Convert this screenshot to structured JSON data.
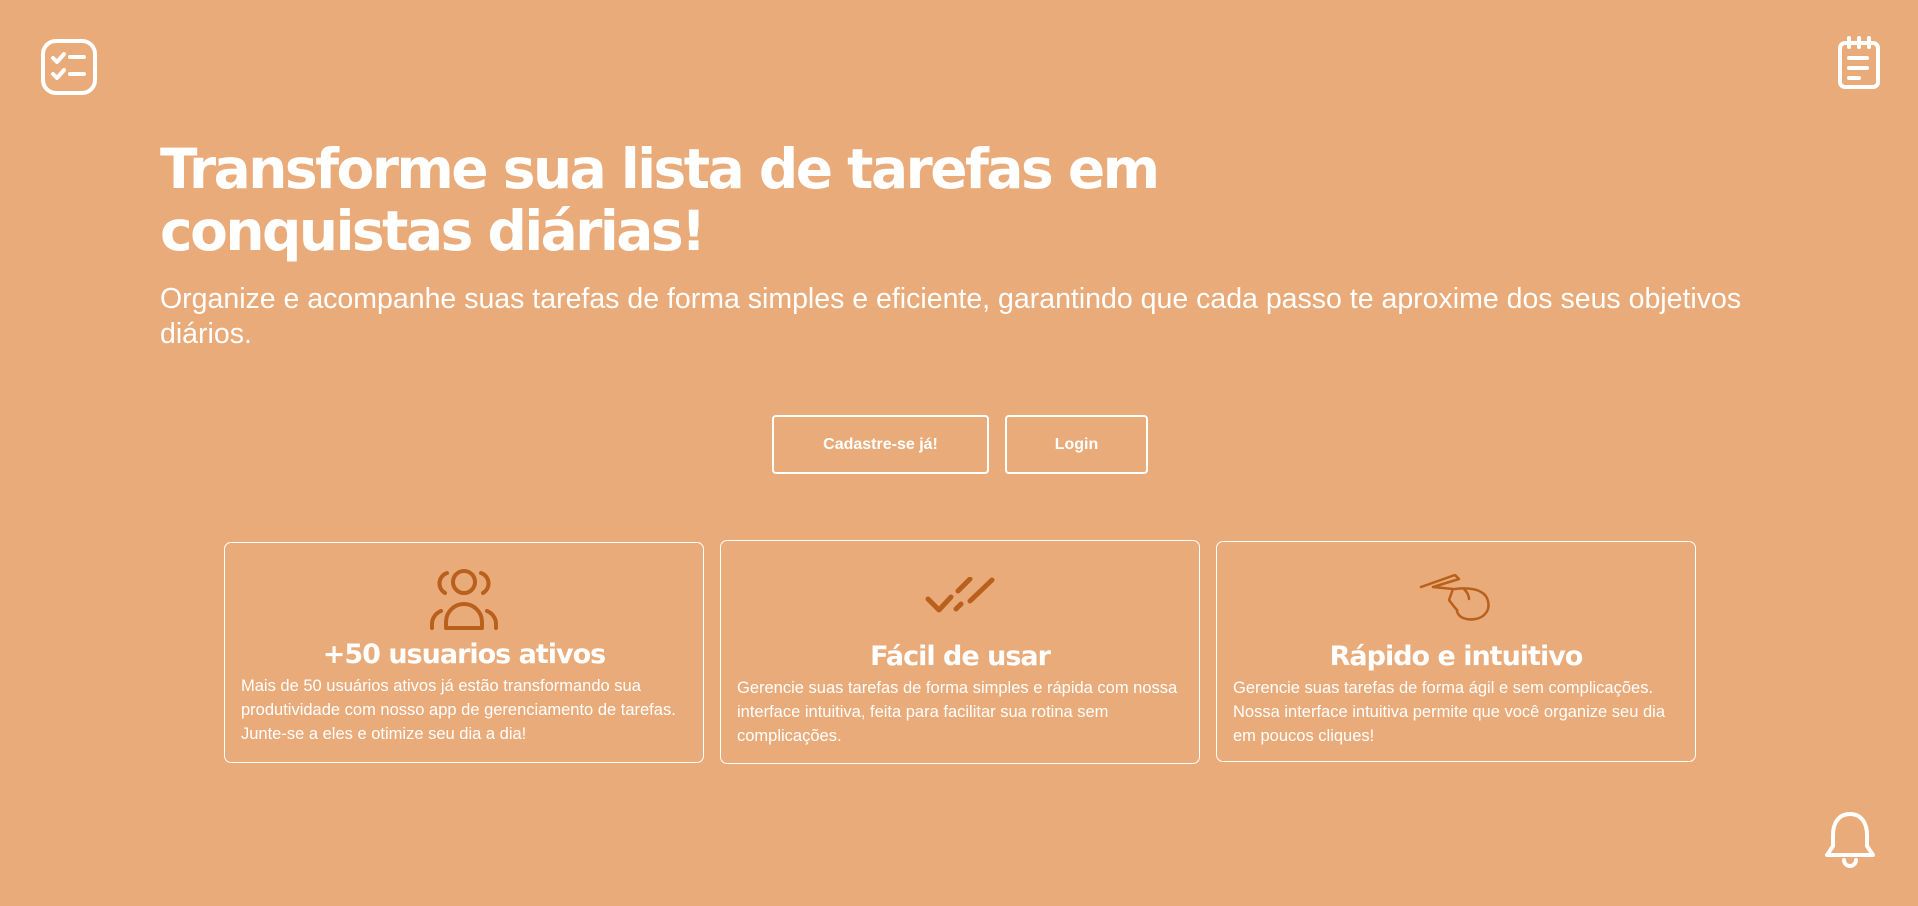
{
  "header": {
    "logo_icon": "checklist-icon",
    "notes_icon": "notepad-icon"
  },
  "hero": {
    "title": "Transforme sua lista de tarefas em\nconquistas diárias!",
    "subtitle": "Organize e acompanhe suas tarefas de forma simples e eficiente, garantindo que cada passo te aproxime dos seus objetivos diários."
  },
  "actions": {
    "signup_label": "Cadastre-se já!",
    "login_label": "Login"
  },
  "features": [
    {
      "icon": "users-icon",
      "title": "+50 usuarios ativos",
      "description": "Mais de 50 usuários ativos já estão transformando sua produtividade com nosso app de gerenciamento de tarefas. Junte-se a eles e otimize seu dia a dia!"
    },
    {
      "icon": "double-check-icon",
      "title": "Fácil de usar",
      "description": "Gerencie suas tarefas de forma simples e rápida com nossa interface intuitiva, feita para facilitar sua rotina sem complicações."
    },
    {
      "icon": "pointing-hand-icon",
      "title": "Rápido e intuitivo",
      "description": "Gerencie suas tarefas de forma ágil e sem complicações. Nossa interface intuitiva permite que você organize seu dia em poucos cliques!"
    }
  ],
  "footer": {
    "notification_icon": "bell-icon"
  },
  "colors": {
    "background": "#EAAB7A",
    "foreground": "#FFFFFF",
    "accent": "#B8601C"
  }
}
